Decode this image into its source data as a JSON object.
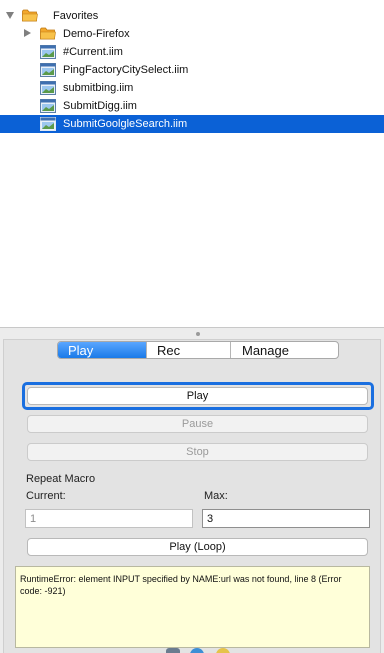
{
  "tree": {
    "root": {
      "label": "Favorites",
      "expanded": true
    },
    "items": [
      {
        "label": "Demo-Firefox",
        "type": "folder",
        "expanded": false
      },
      {
        "label": "#Current.iim",
        "type": "macro"
      },
      {
        "label": "PingFactoryCitySelect.iim",
        "type": "macro"
      },
      {
        "label": "submitbing.iim",
        "type": "macro"
      },
      {
        "label": "SubmitDigg.iim",
        "type": "macro"
      },
      {
        "label": "SubmitGoolgleSearch.iim",
        "type": "macro",
        "selected": true
      }
    ]
  },
  "tabs": [
    {
      "label": "Play",
      "active": true
    },
    {
      "label": "Rec",
      "active": false
    },
    {
      "label": "Manage",
      "active": false
    }
  ],
  "buttons": {
    "play": "Play",
    "pause": "Pause",
    "stop": "Stop",
    "play_loop": "Play (Loop)"
  },
  "repeat": {
    "heading": "Repeat Macro",
    "current_label": "Current:",
    "current_value": "1",
    "max_label": "Max:",
    "max_value": "3"
  },
  "error_message": "RuntimeError: element INPUT specified by NAME:url was not found, line 8 (Error code: -921)",
  "colors": {
    "selection": "#0b61d6",
    "accent": "#1a6fe0",
    "error_bg": "#ffffd9",
    "folder": "#f2a82c"
  }
}
